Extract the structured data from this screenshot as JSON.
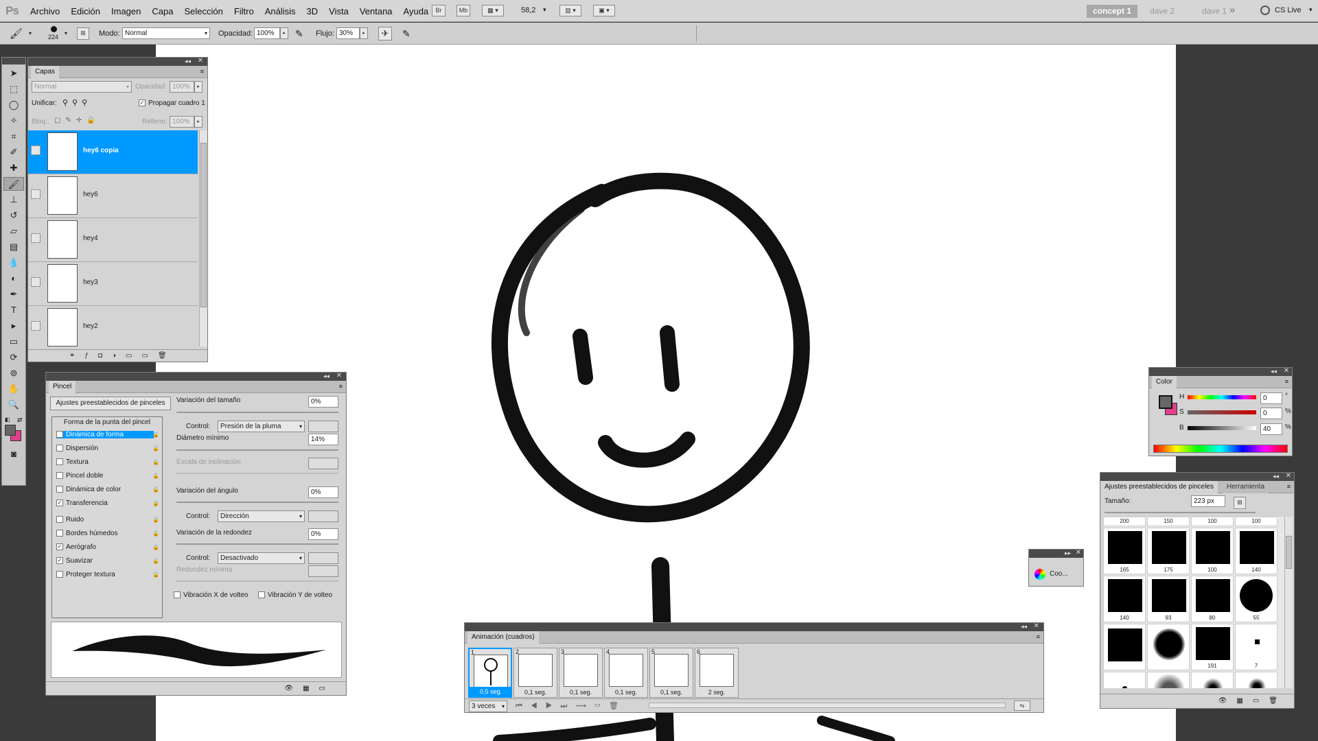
{
  "app": {
    "logo": "Ps",
    "menus": [
      "Archivo",
      "Edición",
      "Imagen",
      "Capa",
      "Selección",
      "Filtro",
      "Análisis",
      "3D",
      "Vista",
      "Ventana",
      "Ayuda"
    ],
    "bridge_btn": "Br",
    "minibridge_btn": "Mb",
    "zoom": "58,2",
    "workspaces": [
      "concept 1",
      "dave 2",
      "dave 1"
    ],
    "more_label": "»",
    "cslive": "CS Live"
  },
  "options": {
    "brush_size": "224",
    "mode_label": "Modo:",
    "mode_value": "Normal",
    "opacity_label": "Opacidad:",
    "opacity_value": "100%",
    "flow_label": "Flujo:",
    "flow_value": "30%"
  },
  "layers": {
    "tab": "Capas",
    "blend": "Normal",
    "opacity_label": "Opacidad:",
    "opacity_value": "100%",
    "unify_label": "Unificar:",
    "propagate_label": "Propagar cuadro 1",
    "lock_label": "Bloq.:",
    "fill_label": "Relleno:",
    "fill_value": "100%",
    "items": [
      {
        "name": "hey6 copia",
        "selected": true
      },
      {
        "name": "hey6",
        "selected": false
      },
      {
        "name": "hey4",
        "selected": false
      },
      {
        "name": "hey3",
        "selected": false
      },
      {
        "name": "hey2",
        "selected": false
      }
    ]
  },
  "brush": {
    "tab": "Pincel",
    "presets_btn": "Ajustes preestablecidos de pinceles",
    "tip_shape": "Forma de la punta del pincel",
    "options": [
      {
        "label": "Dinámica de forma",
        "checked": true,
        "selected": true
      },
      {
        "label": "Dispersión",
        "checked": false
      },
      {
        "label": "Textura",
        "checked": false
      },
      {
        "label": "Pincel doble",
        "checked": false
      },
      {
        "label": "Dinámica de color",
        "checked": false
      },
      {
        "label": "Transferencia",
        "checked": true
      },
      {
        "label": "Ruido",
        "checked": false
      },
      {
        "label": "Bordes húmedos",
        "checked": false
      },
      {
        "label": "Aerógrafo",
        "checked": true
      },
      {
        "label": "Suavizar",
        "checked": true
      },
      {
        "label": "Proteger textura",
        "checked": false
      }
    ],
    "size_jitter_label": "Variación del tamaño",
    "size_jitter_value": "0%",
    "control_label": "Control:",
    "control1": "Presión de la pluma",
    "min_diameter_label": "Diámetro mínimo",
    "min_diameter_value": "14%",
    "tilt_scale_label": "Escala de inclinación",
    "angle_jitter_label": "Variación del ángulo",
    "angle_jitter_value": "0%",
    "control2": "Dirección",
    "roundness_jitter_label": "Variación de la redondez",
    "roundness_jitter_value": "0%",
    "control3": "Desactivado",
    "min_roundness_label": "Redondez mínima",
    "flip_x_label": "Vibración X de volteo",
    "flip_y_label": "Vibración Y de volteo"
  },
  "color": {
    "tab": "Color",
    "h_label": "H",
    "h_value": "0",
    "h_unit": "°",
    "s_label": "S",
    "s_value": "0",
    "s_unit": "%",
    "b_label": "B",
    "b_value": "40",
    "b_unit": "%",
    "fg": "#666666",
    "bg": "#e0408a"
  },
  "brush_presets": {
    "tab1": "Ajustes preestablecidos de pinceles",
    "tab2": "Herramienta",
    "size_label": "Tamaño:",
    "size_value": "223 px",
    "top_row": [
      "200",
      "150",
      "100",
      "100"
    ],
    "cells": [
      "165",
      "175",
      "100",
      "140",
      "140",
      "93",
      "80",
      "55",
      "",
      "",
      "191",
      "7",
      "",
      "",
      "",
      ""
    ]
  },
  "mini_panel": {
    "label": "Coo..."
  },
  "animation": {
    "tab": "Animación (cuadros)",
    "frames": [
      {
        "num": "1",
        "delay": "0,5 seg.",
        "selected": true
      },
      {
        "num": "2",
        "delay": "0,1 seg.",
        "selected": false
      },
      {
        "num": "3",
        "delay": "0,1 seg.",
        "selected": false
      },
      {
        "num": "4",
        "delay": "0,1 seg.",
        "selected": false
      },
      {
        "num": "5",
        "delay": "0,1 seg.",
        "selected": false
      },
      {
        "num": "6",
        "delay": "2 seg.",
        "selected": false
      }
    ],
    "loop": "3 veces"
  }
}
